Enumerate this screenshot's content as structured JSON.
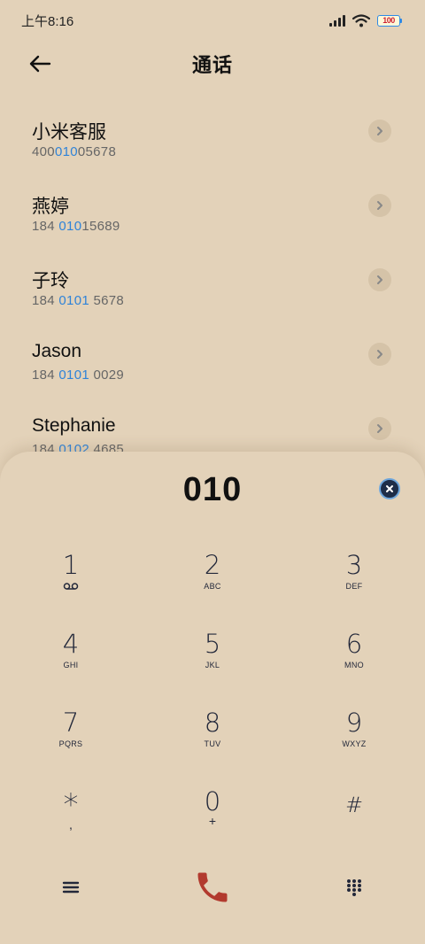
{
  "status_bar": {
    "time": "上午8:16",
    "battery": "100"
  },
  "header": {
    "title": "通话"
  },
  "contacts": [
    {
      "name": "小米客服",
      "number_pre": "400",
      "number_match": "010",
      "number_post": "05678"
    },
    {
      "name": "燕婷",
      "number_pre": "184 ",
      "number_match": "010",
      "number_post": "15689"
    },
    {
      "name": "子玲",
      "number_pre": "184 ",
      "number_match": "0101",
      "number_post": " 5678"
    },
    {
      "name": "Jason",
      "number_pre": "184 ",
      "number_match": "0101",
      "number_post": " 0029"
    },
    {
      "name": "Stephanie",
      "number_pre": "184 ",
      "number_match": "0102",
      "number_post": " 4685"
    }
  ],
  "dialer": {
    "display": "010",
    "keys": [
      {
        "digit": "1",
        "letters": "",
        "sub": "voicemail"
      },
      {
        "digit": "2",
        "letters": "ABC",
        "sub": ""
      },
      {
        "digit": "3",
        "letters": "DEF",
        "sub": ""
      },
      {
        "digit": "4",
        "letters": "GHI",
        "sub": ""
      },
      {
        "digit": "5",
        "letters": "JKL",
        "sub": ""
      },
      {
        "digit": "6",
        "letters": "MNO",
        "sub": ""
      },
      {
        "digit": "7",
        "letters": "PQRS",
        "sub": ""
      },
      {
        "digit": "8",
        "letters": "TUV",
        "sub": ""
      },
      {
        "digit": "9",
        "letters": "WXYZ",
        "sub": ""
      },
      {
        "digit": "*",
        "letters": ",",
        "sub": ""
      },
      {
        "digit": "0",
        "letters": "+",
        "sub": ""
      },
      {
        "digit": "#",
        "letters": "",
        "sub": ""
      }
    ]
  },
  "colors": {
    "background": "#e3d2b9",
    "highlight": "#2f83d8",
    "call_button": "#b23a2e"
  }
}
